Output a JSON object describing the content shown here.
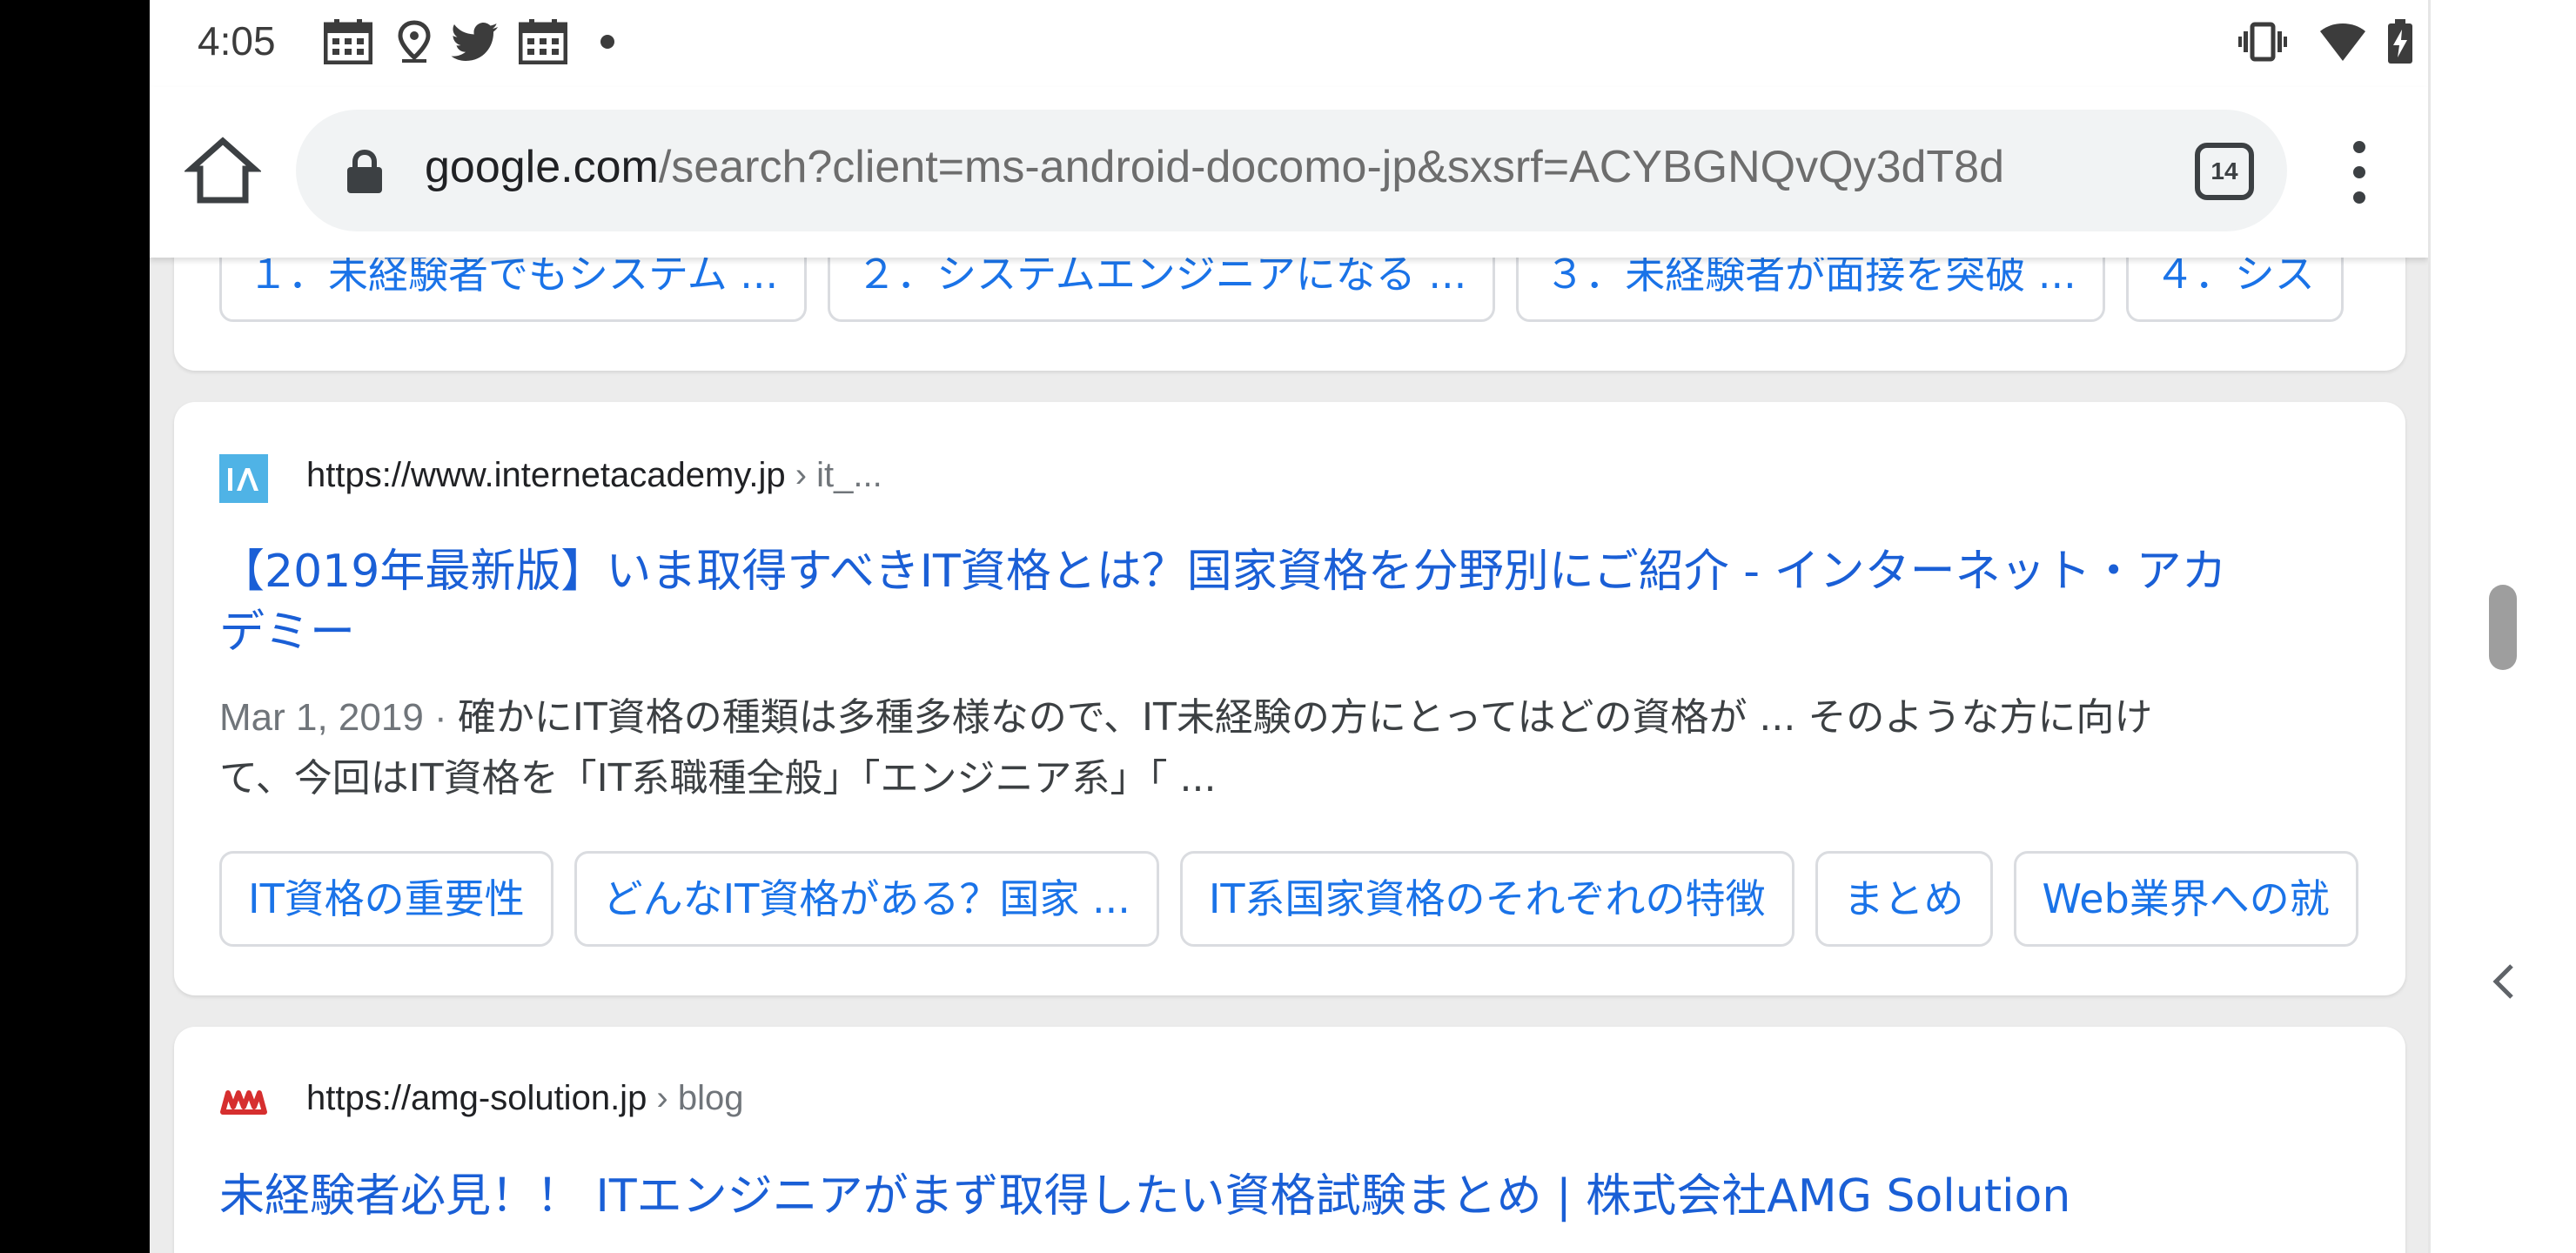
{
  "status_bar": {
    "time": "4:05",
    "left_icons": [
      "calendar-icon",
      "location-icon",
      "twitter-icon",
      "calendar-icon",
      "dot-icon"
    ],
    "right_icons": [
      "vibrate-icon",
      "wifi-icon",
      "battery-charging-icon"
    ]
  },
  "toolbar": {
    "url_host": "google.com",
    "url_path": "/search?client=ms-android-docomo-jp&sxsrf=ACYBGNQvQy3dT8d",
    "tab_count": "14"
  },
  "top_card": {
    "chips": [
      "１．未経験者でもシステム ...",
      "２．システムエンジニアになる ...",
      "３．未経験者が面接を突破 ...",
      "４．シス"
    ]
  },
  "result1": {
    "site_url": "https://www.internetacademy.jp",
    "site_path": " › it_...",
    "title_line1": "【2019年最新版】いま取得すべきIT資格とは？国家資格を分野別にご紹介 - インターネット・アカ",
    "title_line2": "デミー",
    "date": "Mar 1, 2019 · ",
    "snippet_line1": "確かにIT資格の種類は多種多様なので、IT未経験の方にとってはどの資格が ... そのような方に向け",
    "snippet_line2": "て、今回はIT資格を「IT系職種全般」「エンジニア系」「 ...",
    "chips": [
      "IT資格の重要性",
      "どんなIT資格がある？国家 ...",
      "IT系国家資格のそれぞれの特徴",
      "まとめ",
      "Web業界への就"
    ]
  },
  "result2": {
    "site_url": "https://amg-solution.jp",
    "site_path": " › blog",
    "title": "未経験者必見！！ ITエンジニアがまず取得したい資格試験まとめ | 株式会社AMG Solution"
  },
  "colors": {
    "link_blue": "#1a73e8",
    "title_blue": "#1a5fd6",
    "omnibox_bg": "#f1f3f4",
    "background": "#ececec"
  }
}
